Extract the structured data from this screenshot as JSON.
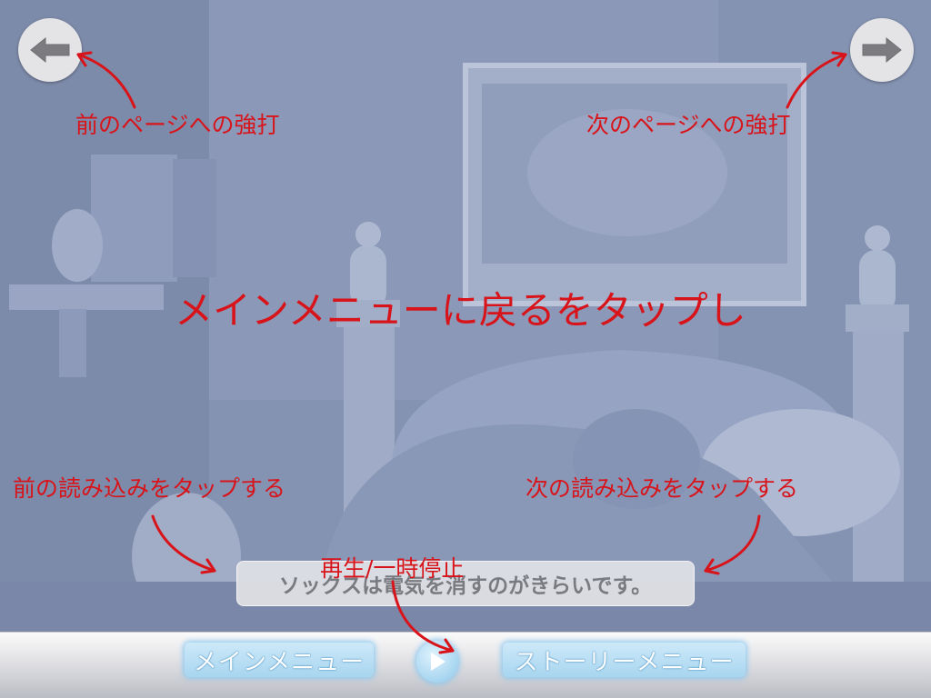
{
  "annotations": {
    "prev_page": "前のページへの強打",
    "next_page": "次のページへの強打",
    "main_menu": "メインメニューに戻るをタップし",
    "prev_read": "前の読み込みをタップする",
    "next_read": "次の読み込みをタップする",
    "play_pause": "再生/一時停止"
  },
  "caption": {
    "text": "ソックスは電気を消すのがきらいです。"
  },
  "bottom_bar": {
    "main_menu_label": "メインメニュー",
    "story_menu_label": "ストーリーメニュー"
  },
  "icons": {
    "prev_page": "arrow-left-icon",
    "next_page": "arrow-right-icon",
    "play": "play-icon"
  },
  "colors": {
    "annotation": "#d8141a",
    "menu_button": "#a8d5ef",
    "nav_button": "#e4e4e6"
  }
}
